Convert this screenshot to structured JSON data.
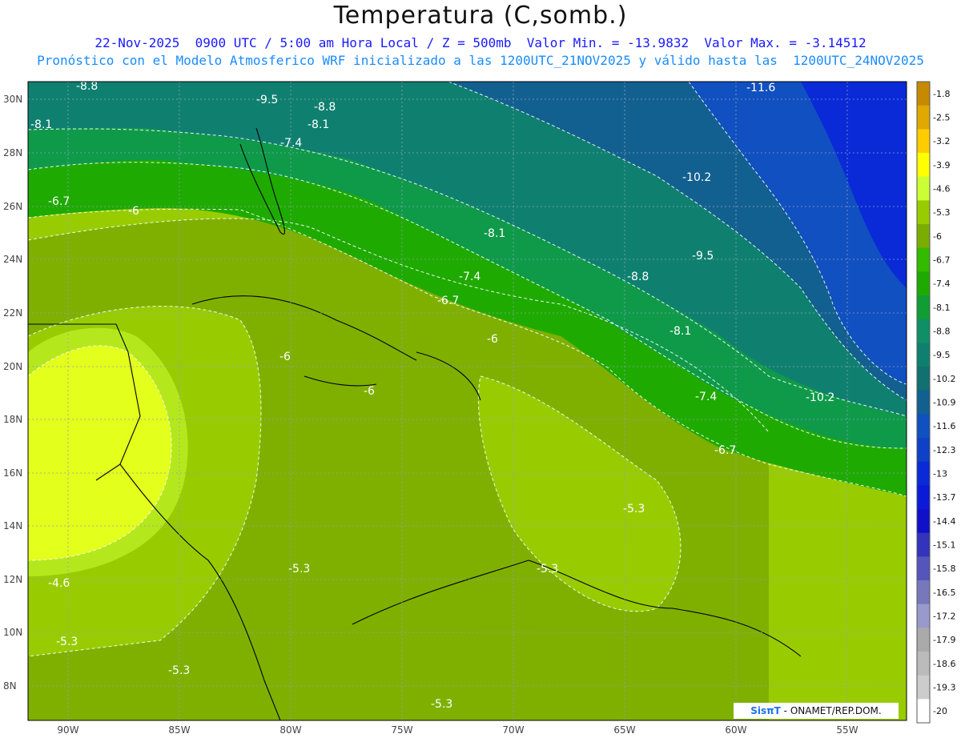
{
  "title": "Temperatura (C,somb.)",
  "subtitle_line1": "22-Nov-2025  0900 UTC / 5:00 am Hora Local / Z = 500mb  Valor Min. = -13.9832  Valor Max. = -3.14512",
  "subtitle_line2": "Pronóstico con el Modelo Atmosferico WRF inicializado a las 1200UTC_21NOV2025 y válido hasta las  1200UTC_24NOV2025",
  "credit": {
    "brand": "SisπT",
    "text": " - ONAMET/REP.DOM."
  },
  "colors": {
    "yellow": "#ffff00",
    "yellow_green": "#ccff33",
    "light_green": "#99cc00",
    "olive_green": "#7fb000",
    "green": "#1faa00",
    "dark_green": "#0f9a4a",
    "teal": "#117f6f",
    "blue": "#0a4fc0",
    "dark_blue": "#0000b0"
  },
  "lat_labels": [
    "30N",
    "28N",
    "26N",
    "24N",
    "22N",
    "20N",
    "18N",
    "16N",
    "14N",
    "12N",
    "10N",
    "8N"
  ],
  "lon_labels": [
    "90W",
    "85W",
    "80W",
    "75W",
    "70W",
    "65W",
    "60W",
    "55W"
  ],
  "colorbar": {
    "levels": [
      "-1.8",
      "-2.5",
      "-3.2",
      "-3.9",
      "-4.6",
      "-5.3",
      "-6",
      "-6.7",
      "-7.4",
      "-8.1",
      "-8.8",
      "-9.5",
      "-10.2",
      "-10.9",
      "-11.6",
      "-12.3",
      "-13",
      "-13.7",
      "-14.4",
      "-15.1",
      "-15.8",
      "-16.5",
      "-17.2",
      "-17.9",
      "-18.6",
      "-19.3",
      "-20"
    ],
    "colors": [
      "#c68a00",
      "#e0a800",
      "#ffcc00",
      "#ffff00",
      "#ccff33",
      "#99cc00",
      "#7aad00",
      "#33bb00",
      "#1faa00",
      "#109d33",
      "#0f8f66",
      "#0f8070",
      "#117070",
      "#126090",
      "#1050c0",
      "#0e40c8",
      "#0a2ad8",
      "#0a1ad8",
      "#1010c8",
      "#3333bb",
      "#5555bb",
      "#7777bb",
      "#9999cc",
      "#aaaaaa",
      "#bbbbbb",
      "#cccccc",
      "#ffffff"
    ]
  },
  "contour_labels": [
    {
      "text": "-8.8"
    },
    {
      "text": "-9.5"
    },
    {
      "text": "-8.8"
    },
    {
      "text": "-8.1"
    },
    {
      "text": "-8.1"
    },
    {
      "text": "-7.4"
    },
    {
      "text": "-11.6"
    },
    {
      "text": "-10.2"
    },
    {
      "text": "-6.7"
    },
    {
      "text": "-6"
    },
    {
      "text": "-8.1"
    },
    {
      "text": "-9.5"
    },
    {
      "text": "-7.4"
    },
    {
      "text": "-8.8"
    },
    {
      "text": "-6.7"
    },
    {
      "text": "-8.1"
    },
    {
      "text": "-6"
    },
    {
      "text": "-6"
    },
    {
      "text": "-6"
    },
    {
      "text": "-7.4"
    },
    {
      "text": "-10.2"
    },
    {
      "text": "-6.7"
    },
    {
      "text": "-5.3"
    },
    {
      "text": "-4.6"
    },
    {
      "text": "-5.3"
    },
    {
      "text": "-5.3"
    },
    {
      "text": "-5.3"
    },
    {
      "text": "-5.3"
    },
    {
      "text": "-5.3"
    }
  ]
}
